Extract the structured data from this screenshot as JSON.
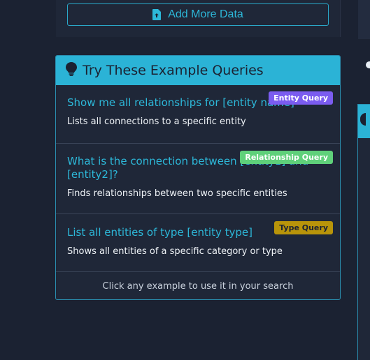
{
  "top": {
    "add_button_label": "Add More Data"
  },
  "examples": {
    "title": "Try These Example Queries",
    "queries": [
      {
        "title": "Show me all relationships for [entity name]",
        "description": "Lists all connections to a specific entity",
        "badge": "Entity Query"
      },
      {
        "title": "What is the connection between [entity1] and [entity2]?",
        "description": "Finds relationships between two specific entities",
        "badge": "Relationship Query"
      },
      {
        "title": "List all entities of type [entity type]",
        "description": "Shows all entities of a specific category or type",
        "badge": "Type Query"
      }
    ],
    "footer": "Click any example to use it in your search"
  },
  "colors": {
    "accent": "#2bb3d6",
    "background": "#1b2232",
    "card": "#1f2738",
    "badge_entity": "#7b5cf0",
    "badge_relationship": "#5fd07a",
    "badge_type": "#b8940a"
  },
  "icons": {
    "add_button": "file-upload-icon",
    "header": "lightbulb-icon"
  }
}
